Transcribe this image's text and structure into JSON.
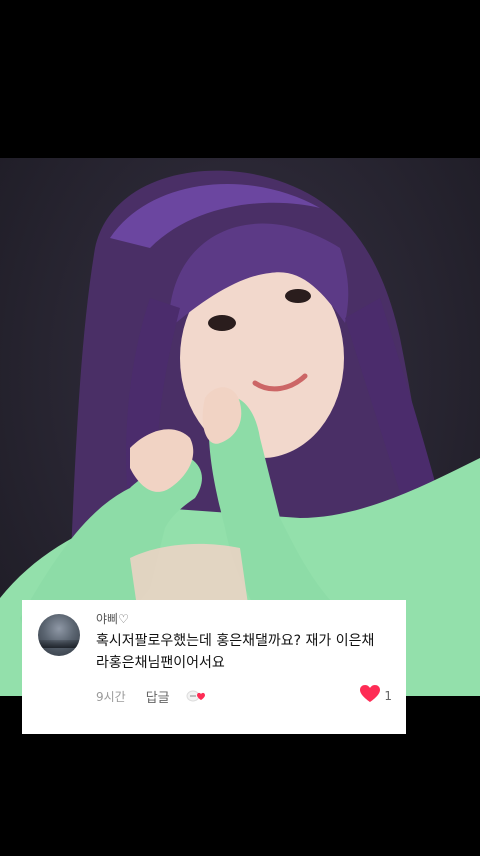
{
  "comment": {
    "username": "야삐♡",
    "text": "혹시저팔로우했는데 홍은채댈까요? 재가 이은채라홍은채님팬이어서요",
    "time": "9시간",
    "reply_label": "답글",
    "like_count": "1",
    "colors": {
      "heart": "#fe2c55"
    }
  },
  "photo": {
    "icon": "photo-person-heart-gesture"
  }
}
